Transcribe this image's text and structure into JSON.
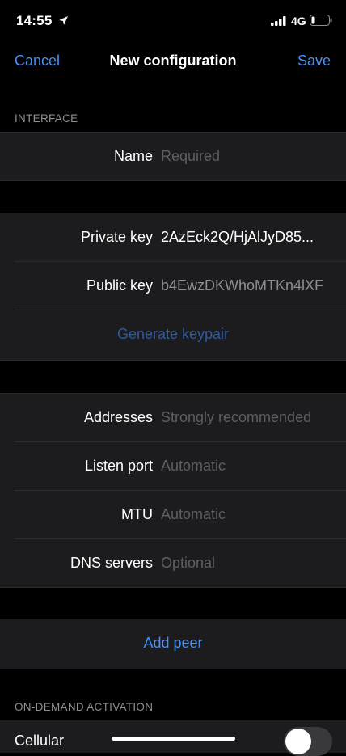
{
  "status_bar": {
    "time": "14:55",
    "network": "4G",
    "icons": [
      "location-arrow-icon",
      "signal-bars-icon",
      "battery-icon"
    ]
  },
  "nav": {
    "cancel_label": "Cancel",
    "title": "New configuration",
    "save_label": "Save"
  },
  "interface": {
    "header": "INTERFACE",
    "name": {
      "label": "Name",
      "placeholder": "Required"
    }
  },
  "keys": {
    "private_key": {
      "label": "Private key",
      "value": "2AzEck2Q/HjAlJyD85..."
    },
    "public_key": {
      "label": "Public key",
      "value": "b4EwzDKWhoMTKn4lXF"
    },
    "generate_label": "Generate keypair"
  },
  "network_settings": {
    "addresses": {
      "label": "Addresses",
      "placeholder": "Strongly recommended"
    },
    "listen_port": {
      "label": "Listen port",
      "placeholder": "Automatic"
    },
    "mtu": {
      "label": "MTU",
      "placeholder": "Automatic"
    },
    "dns": {
      "label": "DNS servers",
      "placeholder": "Optional"
    }
  },
  "peers": {
    "add_label": "Add peer"
  },
  "on_demand": {
    "header": "ON-DEMAND ACTIVATION",
    "cellular": {
      "label": "Cellular",
      "enabled": false
    }
  },
  "colors": {
    "accent": "#4a8ff5",
    "accent_disabled": "#2d5aa0",
    "background": "#000000",
    "cell_background": "#1c1c1e",
    "placeholder": "#5e5e63",
    "section_header": "#8e8e93"
  }
}
